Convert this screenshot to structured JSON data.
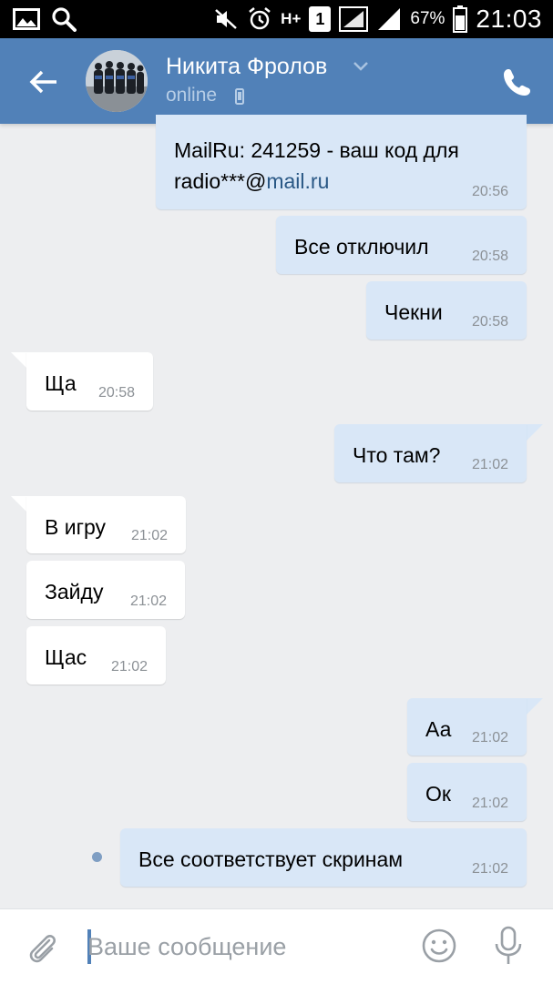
{
  "status_bar": {
    "network": "H+",
    "sim": "1",
    "battery": "67%",
    "time": "21:03"
  },
  "header": {
    "contact_name": "Никита Фролов",
    "status": "online"
  },
  "messages": [
    {
      "direction": "out",
      "text_prefix": "MailRu: 241259 - ваш код для",
      "text_line2_pre": "radio***@",
      "link": "mail.ru",
      "time": "20:56"
    },
    {
      "direction": "out",
      "text": "Все отключил",
      "time": "20:58"
    },
    {
      "direction": "out",
      "text": "Чекни",
      "time": "20:58"
    },
    {
      "direction": "in",
      "text": "Ща",
      "time": "20:58"
    },
    {
      "direction": "out",
      "text": "Что там?",
      "time": "21:02"
    },
    {
      "direction": "in",
      "text": "В игру",
      "time": "21:02"
    },
    {
      "direction": "in",
      "text": "Зайду",
      "time": "21:02"
    },
    {
      "direction": "in",
      "text": "Щас",
      "time": "21:02"
    },
    {
      "direction": "out",
      "text": "Аа",
      "time": "21:02"
    },
    {
      "direction": "out",
      "text": "Ок",
      "time": "21:02"
    },
    {
      "direction": "out",
      "text": "Все соответствует скринам",
      "time": "21:02",
      "unread": true
    }
  ],
  "composer": {
    "placeholder": "Ваше сообщение"
  },
  "colors": {
    "header": "#5181b8",
    "background": "#edeef0",
    "outgoing_bubble": "#d9e7f7",
    "incoming_bubble": "#ffffff",
    "link": "#2a5885"
  },
  "icons": {
    "back": "arrow-left-icon",
    "call": "phone-icon",
    "attach": "paperclip-icon",
    "emoji": "smile-icon",
    "mic": "microphone-icon"
  }
}
